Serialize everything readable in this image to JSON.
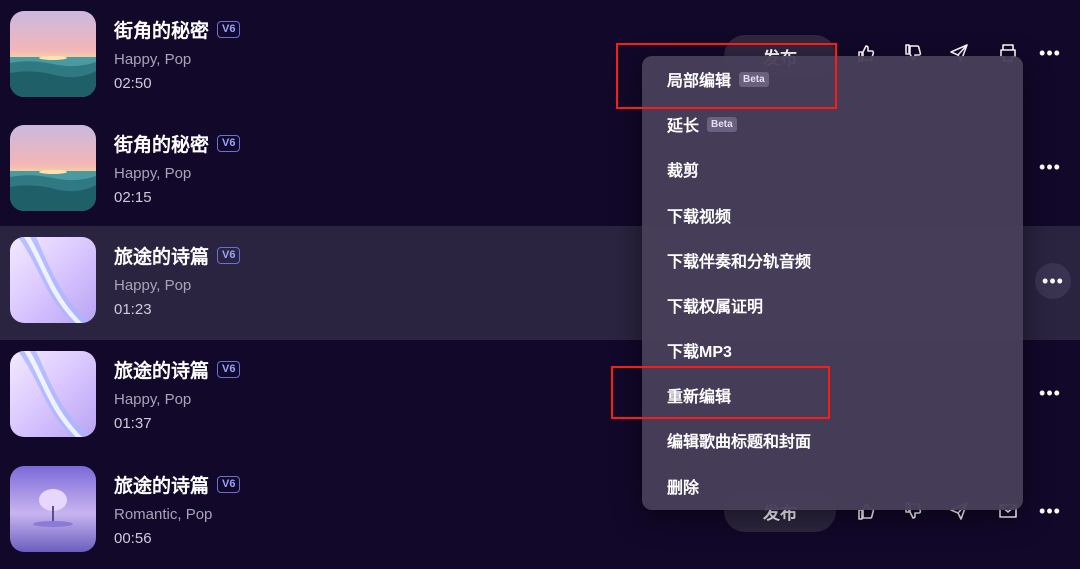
{
  "songs": [
    {
      "title": "街角的秘密",
      "version": "V6",
      "tags": "Happy, Pop",
      "duration": "02:50"
    },
    {
      "title": "街角的秘密",
      "version": "V6",
      "tags": "Happy, Pop",
      "duration": "02:15"
    },
    {
      "title": "旅途的诗篇",
      "version": "V6",
      "tags": "Happy, Pop",
      "duration": "01:23"
    },
    {
      "title": "旅途的诗篇",
      "version": "V6",
      "tags": "Happy, Pop",
      "duration": "01:37"
    },
    {
      "title": "旅途的诗篇",
      "version": "V6",
      "tags": "Romantic, Pop",
      "duration": "00:56"
    }
  ],
  "actions": {
    "publish_label": "发布",
    "more_label": "•••"
  },
  "menu": {
    "items": [
      {
        "label": "局部编辑",
        "badge": "Beta"
      },
      {
        "label": "延长",
        "badge": "Beta"
      },
      {
        "label": "裁剪"
      },
      {
        "label": "下载视频"
      },
      {
        "label": "下载伴奏和分轨音频"
      },
      {
        "label": "下载权属证明"
      },
      {
        "label": "下载MP3"
      },
      {
        "label": "重新编辑"
      },
      {
        "label": "编辑歌曲标题和封面"
      },
      {
        "label": "删除"
      }
    ]
  },
  "icons": {
    "like": "thumbs-up-icon",
    "dislike": "thumbs-down-icon",
    "share": "send-icon",
    "print": "printer-icon",
    "message": "mail-icon",
    "more": "more-icon"
  },
  "colors": {
    "background": "#12082a",
    "selected_row": "#2a2440",
    "menu": "#483e5a",
    "highlight": "#ff1a1a",
    "version_badge": "#9aa2ff"
  }
}
